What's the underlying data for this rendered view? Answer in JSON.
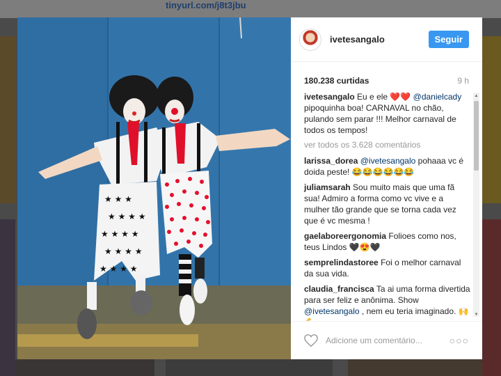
{
  "background": {
    "link_text": "tinyurl.com/j8t3jbu"
  },
  "post": {
    "username": "ivetesangalo",
    "follow_label": "Seguir",
    "likes": "180.238 curtidas",
    "time": "9 h",
    "photo_icon": "photo-clowns"
  },
  "caption": {
    "user": "ivetesangalo",
    "text_before": "Eu e ele ❤️❤️ ",
    "mention": "@danielcady",
    "text_after": " pipoquinha boa! CARNAVAL no chão, pulando sem parar !!! Melhor carnaval de todos os tempos!"
  },
  "view_all": "ver todos os 3.628 comentários",
  "comments": [
    {
      "user": "larissa_dorea",
      "mention": "@ivetesangalo",
      "text": " pohaaa vc é doida peste! 😂😂😂😂😂😂"
    },
    {
      "user": "juliamsarah",
      "mention": "",
      "text": "Sou muito mais que uma fã sua! Admiro a forma como vc vive e a mulher tão grande que se torna cada vez que é vc mesma !"
    },
    {
      "user": "gaelaboreergonomia",
      "mention": "",
      "text": "Folioes como nos, teus Lindos 🖤😍🖤"
    },
    {
      "user": "semprelindastoree",
      "mention": "",
      "text": "Foi o melhor carnaval da sua vida."
    },
    {
      "user": "claudia_francisca",
      "mention": "",
      "text": "Ta ai uma forma divertida para ser feliz e anônima. Show ",
      "mention2": "@ivetesangalo",
      "text2": " , nem eu teria imaginado. 🙌💪"
    }
  ],
  "comment_input_placeholder": "Adicione um comentário...",
  "more_label": "○○○",
  "colors": {
    "accent": "#3897f0",
    "mention": "#003569"
  }
}
